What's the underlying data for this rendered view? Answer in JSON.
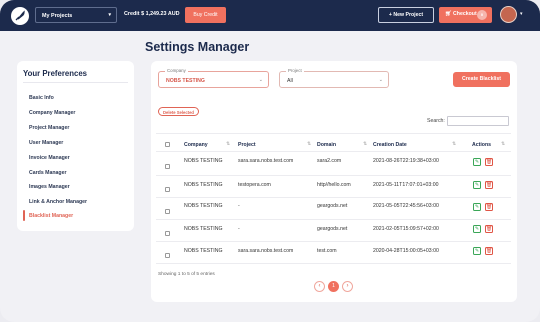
{
  "header": {
    "project_select": "My Projects",
    "credit": "Credit $ 1,249.23 AUD",
    "buy_credit": "Buy Credit",
    "new_project": "+ New Project",
    "checkout": "Checkout",
    "checkout_count": "0"
  },
  "page": {
    "title": "Settings Manager"
  },
  "sidebar": {
    "title": "Your Preferences",
    "items": [
      {
        "label": "Basic Info"
      },
      {
        "label": "Company Manager"
      },
      {
        "label": "Project Manager"
      },
      {
        "label": "User Manager"
      },
      {
        "label": "Invoice Manager"
      },
      {
        "label": "Cards Manager"
      },
      {
        "label": "Images Manager"
      },
      {
        "label": "Link & Anchor Manager"
      },
      {
        "label": "Blacklist Manager"
      }
    ],
    "active": "Blacklist Manager"
  },
  "filters": {
    "company_label": "Company",
    "company_value": "NOBS TESTING",
    "project_label": "Project",
    "project_value": "All",
    "create_button": "Create Blacklist",
    "delete_selected": "Delete Selected",
    "search_label": "Search:"
  },
  "table": {
    "headers": {
      "company": "Company",
      "project": "Project",
      "domain": "Domain",
      "created": "Creation Date",
      "actions": "Actions"
    },
    "rows": [
      {
        "company": "NOBS TESTING",
        "project": "sara.sara.nobs.test.com",
        "domain": "sara2.com",
        "created": "2021-08-26T22:19:38+03:00"
      },
      {
        "company": "NOBS TESTING",
        "project": "testopera.com",
        "domain": "http//hello.com",
        "created": "2021-05-11T17:07:01+03:00"
      },
      {
        "company": "NOBS TESTING",
        "project": "-",
        "domain": "geargods.net",
        "created": "2021-05-05T22:45:56+03:00"
      },
      {
        "company": "NOBS TESTING",
        "project": "-",
        "domain": "geargods.net",
        "created": "2021-02-05T15:09:57+02:00"
      },
      {
        "company": "NOBS TESTING",
        "project": "sara.sara.nobs.test.com",
        "domain": "test.com",
        "created": "2020-04-28T15:00:05+03:00"
      }
    ],
    "showing": "Showing 1 to 5 of 5 entries",
    "current_page": "1"
  },
  "colors": {
    "navy": "#1c2a4c",
    "accent": "#f0715f",
    "edit": "#3aa657",
    "delete": "#e05545"
  }
}
